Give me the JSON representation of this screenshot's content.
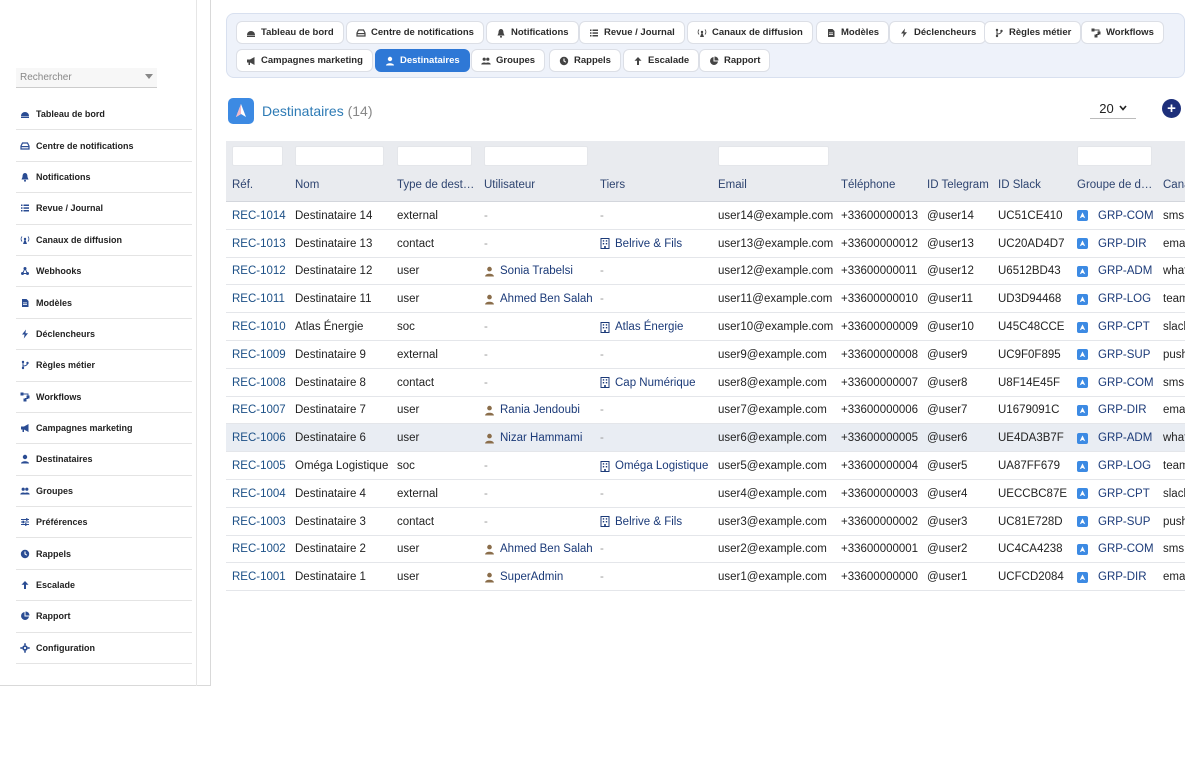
{
  "sidebar": {
    "search_placeholder": "Rechercher",
    "items": [
      {
        "label": "Tableau de bord",
        "icon": "dashboard-icon"
      },
      {
        "label": "Centre de notifications",
        "icon": "inbox-icon"
      },
      {
        "label": "Notifications",
        "icon": "bell-icon"
      },
      {
        "label": "Revue / Journal",
        "icon": "list-icon"
      },
      {
        "label": "Canaux de diffusion",
        "icon": "broadcast-icon"
      },
      {
        "label": "Webhooks",
        "icon": "webhook-icon"
      },
      {
        "label": "Modèles",
        "icon": "document-icon"
      },
      {
        "label": "Déclencheurs",
        "icon": "bolt-icon"
      },
      {
        "label": "Règles métier",
        "icon": "branch-icon"
      },
      {
        "label": "Workflows",
        "icon": "workflow-icon"
      },
      {
        "label": "Campagnes marketing",
        "icon": "megaphone-icon"
      },
      {
        "label": "Destinataires",
        "icon": "user-icon"
      },
      {
        "label": "Groupes",
        "icon": "users-icon"
      },
      {
        "label": "Préférences",
        "icon": "sliders-icon"
      },
      {
        "label": "Rappels",
        "icon": "clock-icon"
      },
      {
        "label": "Escalade",
        "icon": "arrow-up-icon"
      },
      {
        "label": "Rapport",
        "icon": "pie-chart-icon"
      },
      {
        "label": "Configuration",
        "icon": "gear-icon"
      }
    ]
  },
  "tabs": [
    {
      "label": "Tableau de bord",
      "icon": "dashboard-icon",
      "active": false
    },
    {
      "label": "Centre de notifications",
      "icon": "inbox-icon",
      "active": false
    },
    {
      "label": "Notifications",
      "icon": "bell-icon",
      "active": false
    },
    {
      "label": "Revue / Journal",
      "icon": "list-icon",
      "active": false
    },
    {
      "label": "Canaux de diffusion",
      "icon": "broadcast-icon",
      "active": false
    },
    {
      "label": "Modèles",
      "icon": "document-icon",
      "active": false
    },
    {
      "label": "Déclencheurs",
      "icon": "bolt-icon",
      "active": false
    },
    {
      "label": "Règles métier",
      "icon": "branch-icon",
      "active": false
    },
    {
      "label": "Workflows",
      "icon": "workflow-icon",
      "active": false
    },
    {
      "label": "Campagnes marketing",
      "icon": "megaphone-icon",
      "active": false
    },
    {
      "label": "Destinataires",
      "icon": "user-icon",
      "active": true
    },
    {
      "label": "Groupes",
      "icon": "users-icon",
      "active": false
    },
    {
      "label": "Rappels",
      "icon": "clock-icon",
      "active": false
    },
    {
      "label": "Escalade",
      "icon": "arrow-up-icon",
      "active": false
    },
    {
      "label": "Rapport",
      "icon": "pie-chart-icon",
      "active": false
    }
  ],
  "header": {
    "title": "Destinataires",
    "count": "(14)",
    "page_size": "20"
  },
  "table": {
    "columns": [
      "Réf.",
      "Nom",
      "Type de dest…",
      "Utilisateur",
      "Tiers",
      "Email",
      "Téléphone",
      "ID Telegram",
      "ID Slack",
      "Groupe de d…",
      "Cana"
    ],
    "rows": [
      {
        "ref": "REC-1014",
        "nom": "Destinataire 14",
        "type": "external",
        "user": "-",
        "tiers": "-",
        "email": "user14@example.com",
        "tel": "+33600000013",
        "telegram": "@user14",
        "slack": "UC51CE410",
        "groupe": "GRP-COM",
        "canal": "sms"
      },
      {
        "ref": "REC-1013",
        "nom": "Destinataire 13",
        "type": "contact",
        "user": "-",
        "tiers": "Belrive & Fils",
        "email": "user13@example.com",
        "tel": "+33600000012",
        "telegram": "@user13",
        "slack": "UC20AD4D7",
        "groupe": "GRP-DIR",
        "canal": "ema"
      },
      {
        "ref": "REC-1012",
        "nom": "Destinataire 12",
        "type": "user",
        "user": "Sonia Trabelsi",
        "tiers": "-",
        "email": "user12@example.com",
        "tel": "+33600000011",
        "telegram": "@user12",
        "slack": "U6512BD43",
        "groupe": "GRP-ADM",
        "canal": "what"
      },
      {
        "ref": "REC-1011",
        "nom": "Destinataire 11",
        "type": "user",
        "user": "Ahmed Ben Salah",
        "tiers": "-",
        "email": "user11@example.com",
        "tel": "+33600000010",
        "telegram": "@user11",
        "slack": "UD3D94468",
        "groupe": "GRP-LOG",
        "canal": "team"
      },
      {
        "ref": "REC-1010",
        "nom": "Atlas Énergie",
        "type": "soc",
        "user": "-",
        "tiers": "Atlas Énergie",
        "email": "user10@example.com",
        "tel": "+33600000009",
        "telegram": "@user10",
        "slack": "U45C48CCE",
        "groupe": "GRP-CPT",
        "canal": "slack"
      },
      {
        "ref": "REC-1009",
        "nom": "Destinataire 9",
        "type": "external",
        "user": "-",
        "tiers": "-",
        "email": "user9@example.com",
        "tel": "+33600000008",
        "telegram": "@user9",
        "slack": "UC9F0F895",
        "groupe": "GRP-SUP",
        "canal": "push"
      },
      {
        "ref": "REC-1008",
        "nom": "Destinataire 8",
        "type": "contact",
        "user": "-",
        "tiers": "Cap Numérique",
        "email": "user8@example.com",
        "tel": "+33600000007",
        "telegram": "@user8",
        "slack": "U8F14E45F",
        "groupe": "GRP-COM",
        "canal": "sms"
      },
      {
        "ref": "REC-1007",
        "nom": "Destinataire 7",
        "type": "user",
        "user": "Rania Jendoubi",
        "tiers": "-",
        "email": "user7@example.com",
        "tel": "+33600000006",
        "telegram": "@user7",
        "slack": "U1679091C",
        "groupe": "GRP-DIR",
        "canal": "ema"
      },
      {
        "ref": "REC-1006",
        "nom": "Destinataire 6",
        "type": "user",
        "user": "Nizar Hammami",
        "tiers": "-",
        "email": "user6@example.com",
        "tel": "+33600000005",
        "telegram": "@user6",
        "slack": "UE4DA3B7F",
        "groupe": "GRP-ADM",
        "canal": "what"
      },
      {
        "ref": "REC-1005",
        "nom": "Oméga Logistique",
        "type": "soc",
        "user": "-",
        "tiers": "Oméga Logistique",
        "email": "user5@example.com",
        "tel": "+33600000004",
        "telegram": "@user5",
        "slack": "UA87FF679",
        "groupe": "GRP-LOG",
        "canal": "team"
      },
      {
        "ref": "REC-1004",
        "nom": "Destinataire 4",
        "type": "external",
        "user": "-",
        "tiers": "-",
        "email": "user4@example.com",
        "tel": "+33600000003",
        "telegram": "@user4",
        "slack": "UECCBC87E",
        "groupe": "GRP-CPT",
        "canal": "slack"
      },
      {
        "ref": "REC-1003",
        "nom": "Destinataire 3",
        "type": "contact",
        "user": "-",
        "tiers": "Belrive & Fils",
        "email": "user3@example.com",
        "tel": "+33600000002",
        "telegram": "@user3",
        "slack": "UC81E728D",
        "groupe": "GRP-SUP",
        "canal": "push"
      },
      {
        "ref": "REC-1002",
        "nom": "Destinataire 2",
        "type": "user",
        "user": "Ahmed Ben Salah",
        "tiers": "-",
        "email": "user2@example.com",
        "tel": "+33600000001",
        "telegram": "@user2",
        "slack": "UC4CA4238",
        "groupe": "GRP-COM",
        "canal": "sms"
      },
      {
        "ref": "REC-1001",
        "nom": "Destinataire 1",
        "type": "user",
        "user": "SuperAdmin",
        "tiers": "-",
        "email": "user1@example.com",
        "tel": "+33600000000",
        "telegram": "@user1",
        "slack": "UCFCD2084",
        "groupe": "GRP-DIR",
        "canal": "ema"
      }
    ],
    "highlighted_row": 8
  },
  "colors": {
    "accent": "#2e78d6",
    "link": "#1b3a78",
    "title": "#2e7bb5",
    "add_button": "#1d2f7a"
  }
}
